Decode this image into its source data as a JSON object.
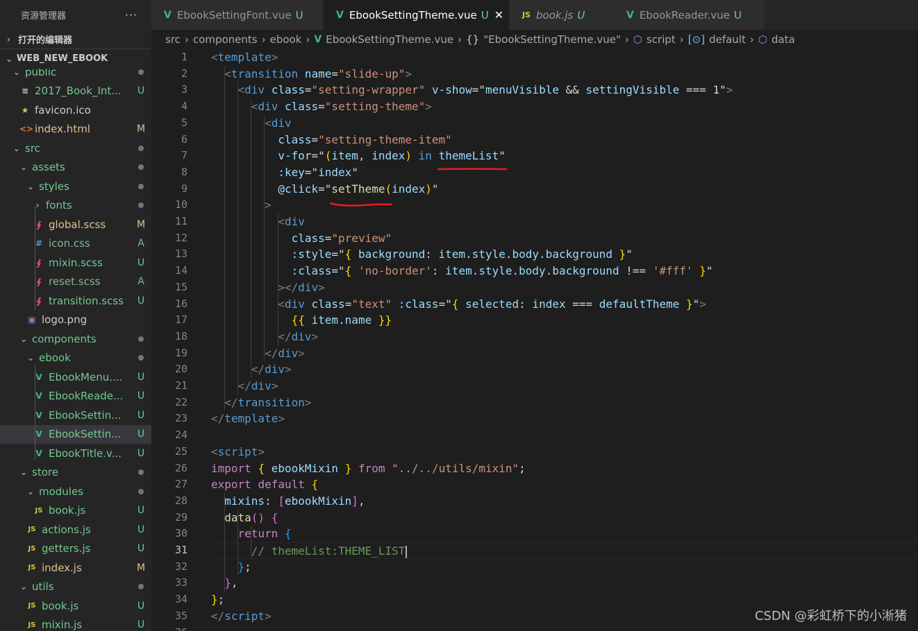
{
  "sidebar": {
    "title": "资源管理器",
    "more": "···",
    "open_editors": "打开的编辑器",
    "project": "WEB_NEW_EBOOK",
    "tree": [
      {
        "label": "public",
        "type": "folder",
        "open": true,
        "depth": 1,
        "badge": "dot",
        "cls": "c-dir"
      },
      {
        "label": "2017_Book_Int...",
        "type": "file",
        "icon": "≡",
        "iconColor": "#cccccc",
        "depth": 2,
        "badge": "U",
        "cls": "c-u"
      },
      {
        "label": "favicon.ico",
        "type": "file",
        "icon": "★",
        "iconColor": "#cbcb41",
        "depth": 2,
        "badge": "",
        "cls": "c-plain"
      },
      {
        "label": "index.html",
        "type": "file",
        "icon": "<>",
        "iconColor": "#e37933",
        "depth": 2,
        "badge": "M",
        "cls": "c-m"
      },
      {
        "label": "src",
        "type": "folder",
        "open": true,
        "depth": 1,
        "badge": "dot",
        "cls": "c-dir"
      },
      {
        "label": "assets",
        "type": "folder",
        "open": true,
        "depth": 2,
        "badge": "dot",
        "cls": "c-dir"
      },
      {
        "label": "styles",
        "type": "folder",
        "open": true,
        "depth": 3,
        "badge": "dot",
        "cls": "c-dir"
      },
      {
        "label": "fonts",
        "type": "folder",
        "open": false,
        "depth": 4,
        "badge": "dot",
        "cls": "c-dir"
      },
      {
        "label": "global.scss",
        "type": "file",
        "icon": "∮",
        "iconColor": "#f55385",
        "depth": 4,
        "badge": "M",
        "cls": "c-m"
      },
      {
        "label": "icon.css",
        "type": "file",
        "icon": "#",
        "iconColor": "#519aba",
        "depth": 4,
        "badge": "A",
        "cls": "c-a"
      },
      {
        "label": "mixin.scss",
        "type": "file",
        "icon": "∮",
        "iconColor": "#f55385",
        "depth": 4,
        "badge": "U",
        "cls": "c-u"
      },
      {
        "label": "reset.scss",
        "type": "file",
        "icon": "∮",
        "iconColor": "#f55385",
        "depth": 4,
        "badge": "A",
        "cls": "c-a"
      },
      {
        "label": "transition.scss",
        "type": "file",
        "icon": "∮",
        "iconColor": "#f55385",
        "depth": 4,
        "badge": "U",
        "cls": "c-u"
      },
      {
        "label": "logo.png",
        "type": "file",
        "icon": "▣",
        "iconColor": "#a074c4",
        "depth": 3,
        "badge": "",
        "cls": "c-plain"
      },
      {
        "label": "components",
        "type": "folder",
        "open": true,
        "depth": 2,
        "badge": "dot",
        "cls": "c-dir"
      },
      {
        "label": "ebook",
        "type": "folder",
        "open": true,
        "depth": 3,
        "badge": "dot",
        "cls": "c-dir"
      },
      {
        "label": "EbookMenu....",
        "type": "file",
        "icon": "V",
        "iconColor": "#41b883",
        "depth": 4,
        "badge": "U",
        "cls": "c-u"
      },
      {
        "label": "EbookReade...",
        "type": "file",
        "icon": "V",
        "iconColor": "#41b883",
        "depth": 4,
        "badge": "U",
        "cls": "c-u"
      },
      {
        "label": "EbookSettin...",
        "type": "file",
        "icon": "V",
        "iconColor": "#41b883",
        "depth": 4,
        "badge": "U",
        "cls": "c-u"
      },
      {
        "label": "EbookSettin...",
        "type": "file",
        "icon": "V",
        "iconColor": "#41b883",
        "depth": 4,
        "badge": "U",
        "cls": "c-u",
        "active": true
      },
      {
        "label": "EbookTitle.v...",
        "type": "file",
        "icon": "V",
        "iconColor": "#41b883",
        "depth": 4,
        "badge": "U",
        "cls": "c-u"
      },
      {
        "label": "store",
        "type": "folder",
        "open": true,
        "depth": 2,
        "badge": "dot",
        "cls": "c-dir"
      },
      {
        "label": "modules",
        "type": "folder",
        "open": true,
        "depth": 3,
        "badge": "dot",
        "cls": "c-dir"
      },
      {
        "label": "book.js",
        "type": "file",
        "icon": "JS",
        "iconColor": "#cbcb41",
        "depth": 4,
        "badge": "U",
        "cls": "c-u"
      },
      {
        "label": "actions.js",
        "type": "file",
        "icon": "JS",
        "iconColor": "#cbcb41",
        "depth": 3,
        "badge": "U",
        "cls": "c-u"
      },
      {
        "label": "getters.js",
        "type": "file",
        "icon": "JS",
        "iconColor": "#cbcb41",
        "depth": 3,
        "badge": "U",
        "cls": "c-u"
      },
      {
        "label": "index.js",
        "type": "file",
        "icon": "JS",
        "iconColor": "#cbcb41",
        "depth": 3,
        "badge": "M",
        "cls": "c-m"
      },
      {
        "label": "utils",
        "type": "folder",
        "open": true,
        "depth": 2,
        "badge": "dot",
        "cls": "c-dir"
      },
      {
        "label": "book.js",
        "type": "file",
        "icon": "JS",
        "iconColor": "#cbcb41",
        "depth": 3,
        "badge": "U",
        "cls": "c-u"
      },
      {
        "label": "mixin.js",
        "type": "file",
        "icon": "JS",
        "iconColor": "#cbcb41",
        "depth": 3,
        "badge": "U",
        "cls": "c-u"
      }
    ]
  },
  "tabs": [
    {
      "label": "EbookSettingFont.vue",
      "icon": "V",
      "status": "U",
      "active": false,
      "italic": false
    },
    {
      "label": "EbookSettingTheme.vue",
      "icon": "V",
      "status": "U",
      "active": true,
      "italic": false,
      "close": "✕"
    },
    {
      "label": "book.js",
      "icon": "JS",
      "status": "U",
      "active": false,
      "italic": true
    },
    {
      "label": "EbookReader.vue",
      "icon": "V",
      "status": "U",
      "active": false,
      "italic": false
    }
  ],
  "breadcrumb": [
    {
      "label": "src"
    },
    {
      "label": "components"
    },
    {
      "label": "ebook"
    },
    {
      "label": "EbookSettingTheme.vue",
      "icon": "V"
    },
    {
      "label": "\"EbookSettingTheme.vue\"",
      "icon": "{}"
    },
    {
      "label": "script",
      "icon": "cube"
    },
    {
      "label": "default",
      "icon": "[⊙]"
    },
    {
      "label": "data",
      "icon": "cube"
    }
  ],
  "editor": {
    "current_line": 31,
    "lines": [
      [
        [
          "tk-punc",
          "<"
        ],
        [
          "tk-tag",
          "template"
        ],
        [
          "tk-punc",
          ">"
        ]
      ],
      [
        [
          "tk-plain",
          "  "
        ],
        [
          "tk-punc",
          "<"
        ],
        [
          "tk-tag",
          "transition"
        ],
        [
          "tk-plain",
          " "
        ],
        [
          "tk-attr",
          "name"
        ],
        [
          "tk-op",
          "="
        ],
        [
          "tk-str",
          "\"slide-up\""
        ],
        [
          "tk-punc",
          ">"
        ]
      ],
      [
        [
          "tk-plain",
          "    "
        ],
        [
          "tk-punc",
          "<"
        ],
        [
          "tk-tag",
          "div"
        ],
        [
          "tk-plain",
          " "
        ],
        [
          "tk-attr",
          "class"
        ],
        [
          "tk-op",
          "="
        ],
        [
          "tk-str",
          "\"setting-wrapper\""
        ],
        [
          "tk-plain",
          " "
        ],
        [
          "tk-attr",
          "v-show"
        ],
        [
          "tk-op",
          "=\""
        ],
        [
          "tk-var",
          "menuVisible"
        ],
        [
          "tk-op",
          " && "
        ],
        [
          "tk-var",
          "settingVisible"
        ],
        [
          "tk-op",
          " === 1\""
        ],
        [
          "tk-punc",
          ">"
        ]
      ],
      [
        [
          "tk-plain",
          "      "
        ],
        [
          "tk-punc",
          "<"
        ],
        [
          "tk-tag",
          "div"
        ],
        [
          "tk-plain",
          " "
        ],
        [
          "tk-attr",
          "class"
        ],
        [
          "tk-op",
          "="
        ],
        [
          "tk-str",
          "\"setting-theme\""
        ],
        [
          "tk-punc",
          ">"
        ]
      ],
      [
        [
          "tk-plain",
          "        "
        ],
        [
          "tk-punc",
          "<"
        ],
        [
          "tk-tag",
          "div"
        ]
      ],
      [
        [
          "tk-plain",
          "          "
        ],
        [
          "tk-attr",
          "class"
        ],
        [
          "tk-op",
          "="
        ],
        [
          "tk-str",
          "\"setting-theme-item\""
        ]
      ],
      [
        [
          "tk-plain",
          "          "
        ],
        [
          "tk-attr",
          "v-for"
        ],
        [
          "tk-op",
          "=\""
        ],
        [
          "tk-brk1",
          "("
        ],
        [
          "tk-var",
          "item"
        ],
        [
          "tk-op",
          ", "
        ],
        [
          "tk-var",
          "index"
        ],
        [
          "tk-brk1",
          ")"
        ],
        [
          "tk-op",
          " "
        ],
        [
          "tk-kw2",
          "in"
        ],
        [
          "tk-op",
          " "
        ],
        [
          "tk-var",
          "themeList"
        ],
        [
          "tk-op",
          "\""
        ]
      ],
      [
        [
          "tk-plain",
          "          "
        ],
        [
          "tk-attr",
          ":key"
        ],
        [
          "tk-op",
          "=\""
        ],
        [
          "tk-var",
          "index"
        ],
        [
          "tk-op",
          "\""
        ]
      ],
      [
        [
          "tk-plain",
          "          "
        ],
        [
          "tk-attr",
          "@click"
        ],
        [
          "tk-op",
          "=\""
        ],
        [
          "tk-fn",
          "setTheme"
        ],
        [
          "tk-brk1",
          "("
        ],
        [
          "tk-var",
          "index"
        ],
        [
          "tk-brk1",
          ")"
        ],
        [
          "tk-op",
          "\""
        ]
      ],
      [
        [
          "tk-plain",
          "        "
        ],
        [
          "tk-punc",
          ">"
        ]
      ],
      [
        [
          "tk-plain",
          "          "
        ],
        [
          "tk-punc",
          "<"
        ],
        [
          "tk-tag",
          "div"
        ]
      ],
      [
        [
          "tk-plain",
          "            "
        ],
        [
          "tk-attr",
          "class"
        ],
        [
          "tk-op",
          "="
        ],
        [
          "tk-str",
          "\"preview\""
        ]
      ],
      [
        [
          "tk-plain",
          "            "
        ],
        [
          "tk-attr",
          ":style"
        ],
        [
          "tk-op",
          "=\""
        ],
        [
          "tk-brk1",
          "{"
        ],
        [
          "tk-op",
          " "
        ],
        [
          "tk-var",
          "background"
        ],
        [
          "tk-op",
          ": "
        ],
        [
          "tk-var",
          "item"
        ],
        [
          "tk-op",
          "."
        ],
        [
          "tk-var",
          "style"
        ],
        [
          "tk-op",
          "."
        ],
        [
          "tk-var",
          "body"
        ],
        [
          "tk-op",
          "."
        ],
        [
          "tk-var",
          "background"
        ],
        [
          "tk-op",
          " "
        ],
        [
          "tk-brk1",
          "}"
        ],
        [
          "tk-op",
          "\""
        ]
      ],
      [
        [
          "tk-plain",
          "            "
        ],
        [
          "tk-attr",
          ":class"
        ],
        [
          "tk-op",
          "=\""
        ],
        [
          "tk-brk1",
          "{"
        ],
        [
          "tk-op",
          " "
        ],
        [
          "tk-str",
          "'no-border'"
        ],
        [
          "tk-op",
          ": "
        ],
        [
          "tk-var",
          "item"
        ],
        [
          "tk-op",
          "."
        ],
        [
          "tk-var",
          "style"
        ],
        [
          "tk-op",
          "."
        ],
        [
          "tk-var",
          "body"
        ],
        [
          "tk-op",
          "."
        ],
        [
          "tk-var",
          "background"
        ],
        [
          "tk-op",
          " !== "
        ],
        [
          "tk-str",
          "'#fff'"
        ],
        [
          "tk-op",
          " "
        ],
        [
          "tk-brk1",
          "}"
        ],
        [
          "tk-op",
          "\""
        ]
      ],
      [
        [
          "tk-plain",
          "          "
        ],
        [
          "tk-punc",
          "></"
        ],
        [
          "tk-tag",
          "div"
        ],
        [
          "tk-punc",
          ">"
        ]
      ],
      [
        [
          "tk-plain",
          "          "
        ],
        [
          "tk-punc",
          "<"
        ],
        [
          "tk-tag",
          "div"
        ],
        [
          "tk-plain",
          " "
        ],
        [
          "tk-attr",
          "class"
        ],
        [
          "tk-op",
          "="
        ],
        [
          "tk-str",
          "\"text\""
        ],
        [
          "tk-plain",
          " "
        ],
        [
          "tk-attr",
          ":class"
        ],
        [
          "tk-op",
          "=\""
        ],
        [
          "tk-brk1",
          "{"
        ],
        [
          "tk-op",
          " "
        ],
        [
          "tk-var",
          "selected"
        ],
        [
          "tk-op",
          ": "
        ],
        [
          "tk-var",
          "index"
        ],
        [
          "tk-op",
          " === "
        ],
        [
          "tk-var",
          "defaultTheme"
        ],
        [
          "tk-op",
          " "
        ],
        [
          "tk-brk1",
          "}"
        ],
        [
          "tk-op",
          "\""
        ],
        [
          "tk-punc",
          ">"
        ]
      ],
      [
        [
          "tk-plain",
          "            "
        ],
        [
          "tk-brk1",
          "{{"
        ],
        [
          "tk-op",
          " "
        ],
        [
          "tk-var",
          "item"
        ],
        [
          "tk-op",
          "."
        ],
        [
          "tk-var",
          "name"
        ],
        [
          "tk-op",
          " "
        ],
        [
          "tk-brk1",
          "}}"
        ]
      ],
      [
        [
          "tk-plain",
          "          "
        ],
        [
          "tk-punc",
          "</"
        ],
        [
          "tk-tag",
          "div"
        ],
        [
          "tk-punc",
          ">"
        ]
      ],
      [
        [
          "tk-plain",
          "        "
        ],
        [
          "tk-punc",
          "</"
        ],
        [
          "tk-tag",
          "div"
        ],
        [
          "tk-punc",
          ">"
        ]
      ],
      [
        [
          "tk-plain",
          "      "
        ],
        [
          "tk-punc",
          "</"
        ],
        [
          "tk-tag",
          "div"
        ],
        [
          "tk-punc",
          ">"
        ]
      ],
      [
        [
          "tk-plain",
          "    "
        ],
        [
          "tk-punc",
          "</"
        ],
        [
          "tk-tag",
          "div"
        ],
        [
          "tk-punc",
          ">"
        ]
      ],
      [
        [
          "tk-plain",
          "  "
        ],
        [
          "tk-punc",
          "</"
        ],
        [
          "tk-tag",
          "transition"
        ],
        [
          "tk-punc",
          ">"
        ]
      ],
      [
        [
          "tk-punc",
          "</"
        ],
        [
          "tk-tag",
          "template"
        ],
        [
          "tk-punc",
          ">"
        ]
      ],
      [],
      [
        [
          "tk-punc",
          "<"
        ],
        [
          "tk-tag",
          "script"
        ],
        [
          "tk-punc",
          ">"
        ]
      ],
      [
        [
          "tk-kw",
          "import"
        ],
        [
          "tk-op",
          " "
        ],
        [
          "tk-brk1",
          "{"
        ],
        [
          "tk-op",
          " "
        ],
        [
          "tk-var",
          "ebookMixin"
        ],
        [
          "tk-op",
          " "
        ],
        [
          "tk-brk1",
          "}"
        ],
        [
          "tk-op",
          " "
        ],
        [
          "tk-kw",
          "from"
        ],
        [
          "tk-op",
          " "
        ],
        [
          "tk-str",
          "\"../../utils/mixin\""
        ],
        [
          "tk-op",
          ";"
        ]
      ],
      [
        [
          "tk-kw",
          "export"
        ],
        [
          "tk-op",
          " "
        ],
        [
          "tk-kw",
          "default"
        ],
        [
          "tk-op",
          " "
        ],
        [
          "tk-brk1",
          "{"
        ]
      ],
      [
        [
          "tk-plain",
          "  "
        ],
        [
          "tk-var",
          "mixins"
        ],
        [
          "tk-op",
          ": "
        ],
        [
          "tk-brk2",
          "["
        ],
        [
          "tk-var",
          "ebookMixin"
        ],
        [
          "tk-brk2",
          "]"
        ],
        [
          "tk-op",
          ","
        ]
      ],
      [
        [
          "tk-plain",
          "  "
        ],
        [
          "tk-fn",
          "data"
        ],
        [
          "tk-brk2",
          "()"
        ],
        [
          "tk-op",
          " "
        ],
        [
          "tk-brk2",
          "{"
        ]
      ],
      [
        [
          "tk-plain",
          "    "
        ],
        [
          "tk-kw",
          "return"
        ],
        [
          "tk-op",
          " "
        ],
        [
          "tk-brk3",
          "{"
        ]
      ],
      [
        [
          "tk-plain",
          "      "
        ],
        [
          "tk-com",
          "// themeList:THEME_LIST"
        ]
      ],
      [
        [
          "tk-plain",
          "    "
        ],
        [
          "tk-brk3",
          "}"
        ],
        [
          "tk-op",
          ";"
        ]
      ],
      [
        [
          "tk-plain",
          "  "
        ],
        [
          "tk-brk2",
          "}"
        ],
        [
          "tk-op",
          ","
        ]
      ],
      [
        [
          "tk-brk1",
          "}"
        ],
        [
          "tk-op",
          ";"
        ]
      ],
      [
        [
          "tk-punc",
          "</"
        ],
        [
          "tk-tag",
          "script"
        ],
        [
          "tk-punc",
          ">"
        ]
      ],
      []
    ]
  },
  "watermark": "CSDN @彩虹桥下的小淅猪"
}
